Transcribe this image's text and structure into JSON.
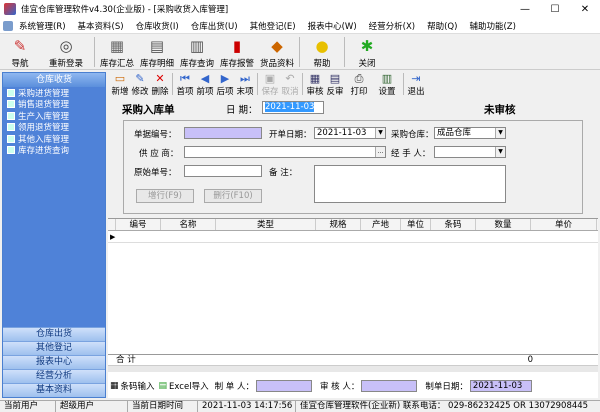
{
  "window": {
    "title": "佳宜仓库管理软件v4.30(企业版)  - [采购收货入库管理]",
    "min": "—",
    "max": "☐",
    "close": "✕"
  },
  "menu": [
    "系统管理(R)",
    "基本资料(S)",
    "仓库收货(I)",
    "仓库出货(U)",
    "其他登记(E)",
    "报表中心(W)",
    "经营分析(X)",
    "帮助(Q)",
    "辅助功能(Z)"
  ],
  "toolbar1": [
    {
      "label": "导航",
      "icon": "navigation-icon",
      "glyph": "✎",
      "color": "#c33"
    },
    {
      "label": "重新登录",
      "icon": "relogin-icon",
      "glyph": "◎",
      "color": "#444"
    },
    {
      "label": "库存汇总",
      "icon": "stock-summary-icon",
      "glyph": "▦",
      "color": "#666"
    },
    {
      "label": "库存明细",
      "icon": "stock-detail-icon",
      "glyph": "▤",
      "color": "#555"
    },
    {
      "label": "库存查询",
      "icon": "stock-query-icon",
      "glyph": "▥",
      "color": "#555"
    },
    {
      "label": "库存报警",
      "icon": "stock-alarm-icon",
      "glyph": "▮",
      "color": "#c00"
    },
    {
      "label": "货品资料",
      "icon": "goods-info-icon",
      "glyph": "◆",
      "color": "#c60"
    },
    {
      "label": "帮助",
      "icon": "help-icon",
      "glyph": "●",
      "color": "#e8c000"
    },
    {
      "label": "关闭",
      "icon": "close-app-icon",
      "glyph": "✱",
      "color": "#2a2"
    }
  ],
  "sidebar": {
    "header": "仓库收货",
    "items": [
      "采购进货管理",
      "销售退货管理",
      "生产入库管理",
      "领用退货管理",
      "其他入库管理",
      "库存进货查询"
    ],
    "bottom": [
      "仓库出货",
      "其他登记",
      "报表中心",
      "经营分析",
      "基本资料"
    ]
  },
  "toolbar2": [
    {
      "label": "新增",
      "icon": "new-icon",
      "glyph": "▭",
      "disabled": false
    },
    {
      "label": "修改",
      "icon": "edit-icon",
      "glyph": "✎",
      "disabled": false
    },
    {
      "label": "删除",
      "icon": "delete-icon",
      "glyph": "✕",
      "disabled": false
    },
    {
      "label": "首项",
      "icon": "first-icon",
      "glyph": "⏮",
      "disabled": false
    },
    {
      "label": "前项",
      "icon": "prev-icon",
      "glyph": "◀",
      "disabled": false
    },
    {
      "label": "后项",
      "icon": "next-icon",
      "glyph": "▶",
      "disabled": false
    },
    {
      "label": "末项",
      "icon": "last-icon",
      "glyph": "⏭",
      "disabled": false
    },
    {
      "label": "保存",
      "icon": "save-icon",
      "glyph": "▣",
      "disabled": true
    },
    {
      "label": "取消",
      "icon": "cancel-icon",
      "glyph": "↶",
      "disabled": true
    },
    {
      "label": "审核",
      "icon": "audit-icon",
      "glyph": "▦",
      "disabled": false
    },
    {
      "label": "反审",
      "icon": "unaudit-icon",
      "glyph": "▤",
      "disabled": false
    },
    {
      "label": "打印",
      "icon": "print-icon",
      "glyph": "⎙",
      "disabled": false
    },
    {
      "label": "设置",
      "icon": "settings-icon",
      "glyph": "▥",
      "disabled": false
    },
    {
      "label": "退出",
      "icon": "exit-icon",
      "glyph": "⇥",
      "disabled": false
    }
  ],
  "form": {
    "title": "采购入库单",
    "date_label": "日  期：",
    "date_value": "2021-11-03",
    "status": "未审核",
    "bill_no_label": "单据编号：",
    "bill_no_value": "",
    "open_date_label": "开单日期：",
    "open_date_value": "2021-11-03",
    "warehouse_label": "采购仓库：",
    "warehouse_value": "成品仓库",
    "supplier_label": "供 应 商：",
    "supplier_value": "",
    "handler_label": "经 手 人：",
    "handler_value": "",
    "orig_no_label": "原始单号：",
    "orig_no_value": "",
    "remark_label": "备    注：",
    "remark_value": "",
    "add_row_button": "增行(F9)",
    "del_row_button": "删行(F10)"
  },
  "grid": {
    "columns": [
      "编号",
      "名称",
      "类型",
      "规格",
      "产地",
      "单位",
      "条码",
      "数量",
      "单价"
    ],
    "total_label": "合  计",
    "total_qty": "0"
  },
  "bottom": {
    "barcode_input": "条码输入",
    "excel_import": "Excel导入",
    "maker_label": "制 单 人：",
    "maker_value": "",
    "auditor_label": "审 核 人：",
    "auditor_value": "",
    "make_date_label": "制单日期：",
    "make_date_value": "2021-11-03"
  },
  "statusbar": [
    "当前用户",
    "超级用户",
    "当前日期时间",
    "2021-11-03  14:17:56",
    "佳宜仓库管理软件(企业新)  联系电话： 029-86232425 OR 13072908445"
  ]
}
